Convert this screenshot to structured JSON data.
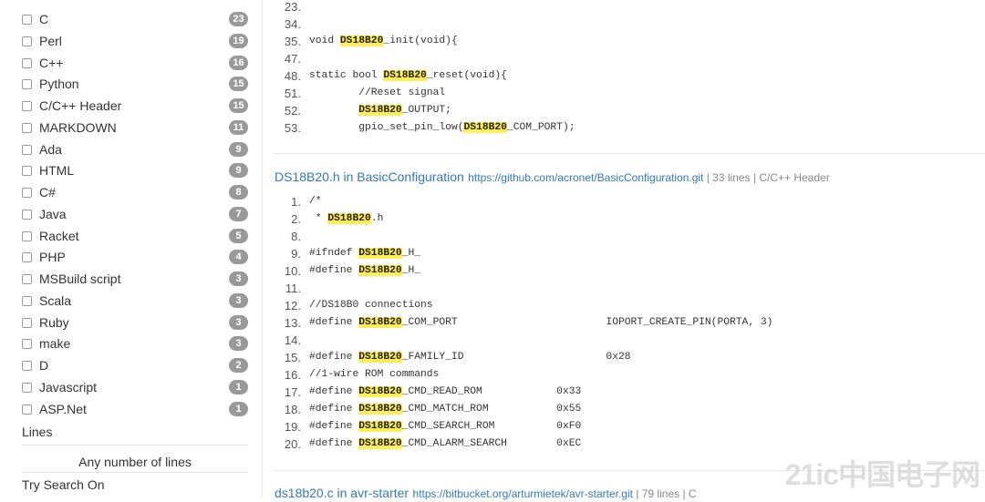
{
  "sidebar": {
    "languages": [
      {
        "label": "C",
        "count": "23"
      },
      {
        "label": "Perl",
        "count": "19"
      },
      {
        "label": "C++",
        "count": "16"
      },
      {
        "label": "Python",
        "count": "15"
      },
      {
        "label": "C/C++ Header",
        "count": "15"
      },
      {
        "label": "MARKDOWN",
        "count": "11"
      },
      {
        "label": "Ada",
        "count": "9"
      },
      {
        "label": "HTML",
        "count": "9"
      },
      {
        "label": "C#",
        "count": "8"
      },
      {
        "label": "Java",
        "count": "7"
      },
      {
        "label": "Racket",
        "count": "5"
      },
      {
        "label": "PHP",
        "count": "4"
      },
      {
        "label": "MSBuild script",
        "count": "3"
      },
      {
        "label": "Scala",
        "count": "3"
      },
      {
        "label": "Ruby",
        "count": "3"
      },
      {
        "label": "make",
        "count": "3"
      },
      {
        "label": "D",
        "count": "2"
      },
      {
        "label": "Javascript",
        "count": "1"
      },
      {
        "label": "ASP.Net",
        "count": "1"
      }
    ],
    "lines_heading": "Lines",
    "lines_option": "Any number of lines",
    "try_search": "Try Search On"
  },
  "results": [
    {
      "lines": [
        {
          "num": "23.",
          "pre": "",
          "hl": "",
          "post": ""
        },
        {
          "num": "34.",
          "pre": "",
          "hl": "",
          "post": ""
        },
        {
          "num": "35.",
          "pre": "void ",
          "hl": "DS18B20",
          "post": "_init(void){"
        },
        {
          "num": "47.",
          "pre": "",
          "hl": "",
          "post": ""
        },
        {
          "num": "48.",
          "pre": "static bool ",
          "hl": "DS18B20",
          "post": "_reset(void){"
        },
        {
          "num": "51.",
          "pre": "        //Reset signal",
          "hl": "",
          "post": ""
        },
        {
          "num": "52.",
          "pre": "        ",
          "hl": "DS18B20",
          "post": "_OUTPUT;"
        },
        {
          "num": "53.",
          "pre": "        gpio_set_pin_low(",
          "hl": "DS18B20",
          "post": "_COM_PORT);"
        }
      ]
    },
    {
      "title": "DS18B20.h in BasicConfiguration",
      "url": "https://github.com/acronet/BasicConfiguration.git",
      "meta": " | 33 lines | C/C++ Header",
      "lines": [
        {
          "num": "1.",
          "pre": "/*",
          "hl": "",
          "post": ""
        },
        {
          "num": "2.",
          "pre": " * ",
          "hl": "DS18B20",
          "post": ".h"
        },
        {
          "num": "8.",
          "pre": "",
          "hl": "",
          "post": ""
        },
        {
          "num": "9.",
          "pre": "#ifndef ",
          "hl": "DS18B20",
          "post": "_H_"
        },
        {
          "num": "10.",
          "pre": "#define ",
          "hl": "DS18B20",
          "post": "_H_"
        },
        {
          "num": "11.",
          "pre": "",
          "hl": "",
          "post": ""
        },
        {
          "num": "12.",
          "pre": "//DS18B0 connections",
          "hl": "",
          "post": ""
        },
        {
          "num": "13.",
          "pre": "#define ",
          "hl": "DS18B20",
          "post": "_COM_PORT                        IOPORT_CREATE_PIN(PORTA, 3)"
        },
        {
          "num": "14.",
          "pre": "",
          "hl": "",
          "post": ""
        },
        {
          "num": "15.",
          "pre": "#define ",
          "hl": "DS18B20",
          "post": "_FAMILY_ID                       0x28"
        },
        {
          "num": "16.",
          "pre": "//1-wire ROM commands",
          "hl": "",
          "post": ""
        },
        {
          "num": "17.",
          "pre": "#define ",
          "hl": "DS18B20",
          "post": "_CMD_READ_ROM            0x33"
        },
        {
          "num": "18.",
          "pre": "#define ",
          "hl": "DS18B20",
          "post": "_CMD_MATCH_ROM           0x55"
        },
        {
          "num": "19.",
          "pre": "#define ",
          "hl": "DS18B20",
          "post": "_CMD_SEARCH_ROM          0xF0"
        },
        {
          "num": "20.",
          "pre": "#define ",
          "hl": "DS18B20",
          "post": "_CMD_ALARM_SEARCH        0xEC"
        }
      ]
    },
    {
      "title": "ds18b20.c in avr-starter",
      "url": "https://bitbucket.org/arturmietek/avr-starter.git",
      "meta": " | 79 lines | C",
      "lines": []
    }
  ],
  "watermark": "21ic中国电子网"
}
